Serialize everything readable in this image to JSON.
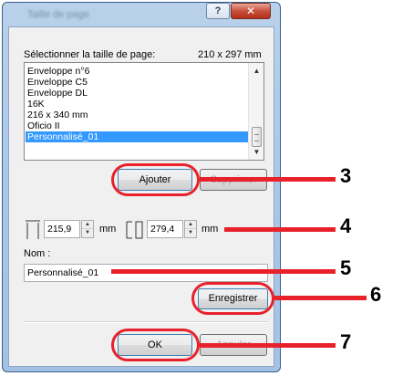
{
  "window": {
    "title": "Taille de page",
    "help_glyph": "?",
    "close_glyph": "✕"
  },
  "page_size": {
    "label": "Sélectionner la taille de page:",
    "value": "210 x 297 mm"
  },
  "list": {
    "items": [
      "Enveloppe n°6",
      "Enveloppe C5",
      "Enveloppe DL",
      "16K",
      "216 x 340 mm",
      "Oficio II",
      "Personnalisé_01"
    ],
    "selected_index": 6
  },
  "buttons": {
    "add": "Ajouter",
    "delete": "Supprimer",
    "save": "Enregistrer",
    "ok": "OK",
    "cancel": "Annuler"
  },
  "dimensions": {
    "width_value": "215,9",
    "height_value": "279,4",
    "unit": "mm",
    "width_icon": "width-icon",
    "height_icon": "height-icon"
  },
  "name": {
    "label": "Nom :",
    "value": "Personnalisé_01"
  },
  "callouts": [
    "3",
    "4",
    "5",
    "6",
    "7"
  ],
  "colors": {
    "annotation": "#e8212b",
    "selection": "#3399ff"
  }
}
